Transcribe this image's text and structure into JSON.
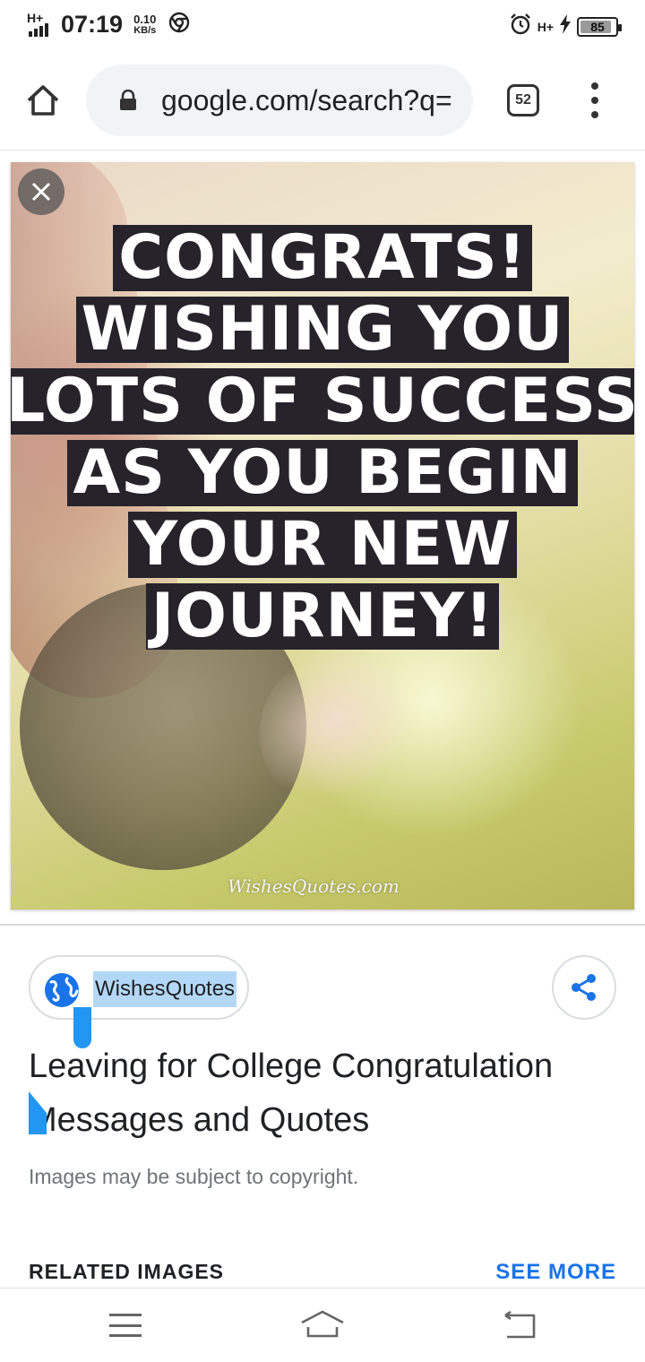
{
  "status_bar": {
    "network": "H+",
    "time": "07:19",
    "speed_value": "0.10",
    "speed_unit": "KB/s",
    "network_right": "H+",
    "battery": "85"
  },
  "toolbar": {
    "url": "google.com/search?q=",
    "tab_count": "52"
  },
  "image": {
    "quote_lines": [
      "CONGRATS!",
      "WISHING YOU",
      "LOTS OF SUCCESS",
      "AS YOU BEGIN",
      "YOUR NEW",
      "JOURNEY!"
    ],
    "watermark": "WishesQuotes.com"
  },
  "result": {
    "source_name": "WishesQuotes",
    "title": "Leaving for College Congratulation Messages and Quotes",
    "copyright_note": "Images may be subject to copyright.",
    "related_label": "RELATED IMAGES",
    "see_more_label": "SEE MORE"
  },
  "colors": {
    "accent": "#1a73e8",
    "selection": "#b3d8f7",
    "selection_handle": "#2196f3"
  }
}
